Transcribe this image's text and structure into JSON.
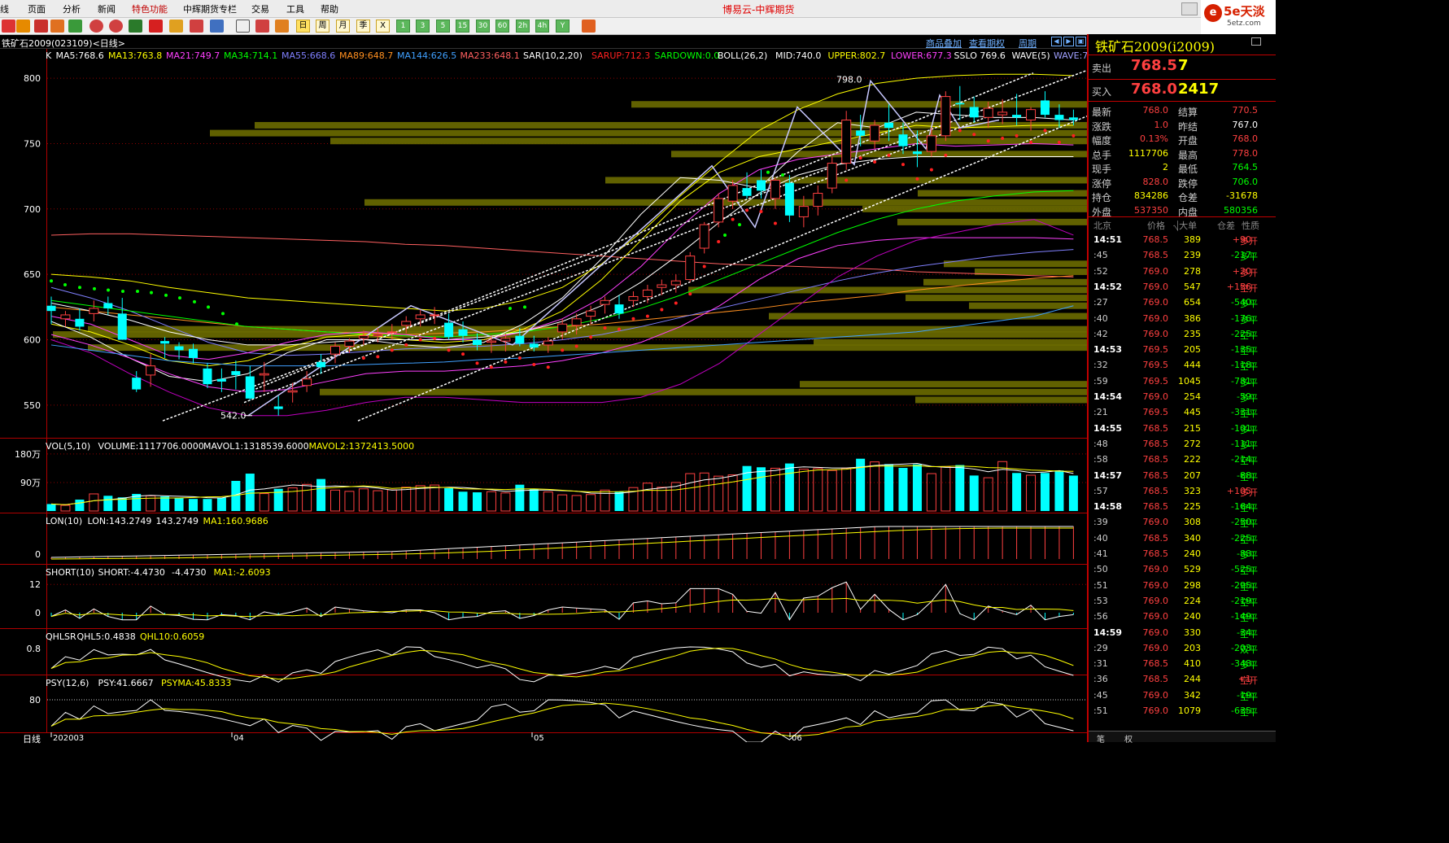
{
  "app": {
    "title": "博易云-中辉期货"
  },
  "logo": {
    "text": "5e天淡",
    "sub": "5etz.com",
    "mark": "e"
  },
  "menu": [
    "线",
    "页面",
    "分析",
    "新闻",
    "特色功能",
    "中辉期货专栏",
    "交易",
    "工具",
    "帮助"
  ],
  "toolbar": {
    "periods": [
      "日",
      "周",
      "月",
      "季",
      "X"
    ],
    "minutes": [
      "1",
      "3",
      "5",
      "15",
      "30",
      "60",
      "2h",
      "4h",
      "Y"
    ]
  },
  "subbar": {
    "title": "铁矿石2009(023109)<日线>",
    "links": [
      "商品叠加",
      "查看期权",
      "周期"
    ]
  },
  "main_panel": {
    "indicator_line": [
      {
        "t": "K",
        "c": "#ffffff"
      },
      {
        "t": "MA5:768.6",
        "c": "#ffffff"
      },
      {
        "t": "MA13:763.8",
        "c": "#ffff00"
      },
      {
        "t": "MA21:749.7",
        "c": "#ff40ff"
      },
      {
        "t": "MA34:714.1",
        "c": "#00ff00"
      },
      {
        "t": "MA55:668.6",
        "c": "#8080ff"
      },
      {
        "t": "MA89:648.7",
        "c": "#ff9020"
      },
      {
        "t": "MA144:626.5",
        "c": "#40a0ff"
      },
      {
        "t": "MA233:648.1",
        "c": "#ff6060"
      },
      {
        "t": "SAR(10,2,20)",
        "c": "#ffffff"
      },
      {
        "t": "SARUP:712.3",
        "c": "#ff2020"
      },
      {
        "t": "SARDOWN:0.0",
        "c": "#00ff00"
      },
      {
        "t": "BOLL(26,2)",
        "c": "#ffffff"
      },
      {
        "t": "MID:740.0",
        "c": "#ffffff"
      },
      {
        "t": "UPPER:802.7",
        "c": "#ffff00"
      },
      {
        "t": "LOWER:677.3",
        "c": "#ff40ff"
      },
      {
        "t": "SSLO 769.6",
        "c": "#ffffff"
      },
      {
        "t": "WAVE(5)",
        "c": "#ffffff"
      },
      {
        "t": "WAVE:768.0",
        "c": "#a0a0ff"
      }
    ],
    "yticks": [
      "800",
      "750",
      "700",
      "650",
      "600",
      "550"
    ],
    "annotations": {
      "high": "798.0",
      "low": "542.0"
    }
  },
  "vol_panel": {
    "indicator_line": [
      {
        "t": "VOL(5,10)",
        "c": "#ffffff"
      },
      {
        "t": "VOLUME:1117706.0000",
        "c": "#ffffff"
      },
      {
        "t": "MAVOL1:1318539.6000",
        "c": "#ffffff"
      },
      {
        "t": "MAVOL2:1372413.5000",
        "c": "#ffff00"
      }
    ],
    "yticks": [
      "180万",
      "90万"
    ]
  },
  "lon_panel": {
    "indicator_line": [
      {
        "t": "LON(10)",
        "c": "#ffffff"
      },
      {
        "t": "LON:143.2749",
        "c": "#ffffff"
      },
      {
        "t": "143.2749",
        "c": "#ffffff"
      },
      {
        "t": "MA1:160.9686",
        "c": "#ffff00"
      }
    ],
    "yticks": [
      "0"
    ]
  },
  "short_panel": {
    "indicator_line": [
      {
        "t": "SHORT(10)",
        "c": "#ffffff"
      },
      {
        "t": "SHORT:-4.4730",
        "c": "#ffffff"
      },
      {
        "t": "-4.4730",
        "c": "#ffffff"
      },
      {
        "t": "MA1:-2.6093",
        "c": "#ffff00"
      }
    ],
    "yticks": [
      "12",
      "0"
    ]
  },
  "qhl_panel": {
    "indicator_line": [
      {
        "t": "QHLSR",
        "c": "#ffffff"
      },
      {
        "t": "QHL5:0.4838",
        "c": "#ffffff"
      },
      {
        "t": "QHL10:0.6059",
        "c": "#ffff00"
      }
    ],
    "yticks": [
      "0.8"
    ]
  },
  "psy_panel": {
    "indicator_line": [
      {
        "t": "PSY(12,6)",
        "c": "#ffffff"
      },
      {
        "t": "PSY:41.6667",
        "c": "#ffffff"
      },
      {
        "t": "PSYMA:45.8333",
        "c": "#ffff00"
      }
    ],
    "yticks": [
      "80"
    ]
  },
  "xaxis": {
    "labels": [
      "202003",
      "04",
      "05",
      "06"
    ],
    "period_label": "日线"
  },
  "chart_data": {
    "type": "candlestick",
    "yrange": [
      530,
      815
    ],
    "candles": [
      [
        626,
        633,
        612,
        622
      ],
      [
        616,
        622,
        610,
        619
      ],
      [
        616,
        624,
        607,
        610
      ],
      [
        620,
        630,
        614,
        624
      ],
      [
        628,
        633,
        619,
        624
      ],
      [
        620,
        632,
        602,
        600
      ],
      [
        571,
        576,
        560,
        562
      ],
      [
        573,
        589,
        564,
        580
      ],
      [
        599,
        602,
        586,
        597
      ],
      [
        595,
        598,
        585,
        592
      ],
      [
        593,
        597,
        582,
        586
      ],
      [
        578,
        582,
        563,
        566
      ],
      [
        570,
        578,
        560,
        568
      ],
      [
        576,
        584,
        562,
        573
      ],
      [
        572,
        580,
        554,
        555
      ],
      [
        573,
        583,
        560,
        574
      ],
      [
        549,
        557,
        542,
        547
      ],
      [
        560,
        567,
        552,
        561
      ],
      [
        565,
        576,
        560,
        570
      ],
      [
        583,
        589,
        574,
        579
      ],
      [
        589,
        598,
        582,
        595
      ],
      [
        595,
        601,
        590,
        599
      ],
      [
        601,
        607,
        596,
        603
      ],
      [
        603,
        609,
        598,
        604
      ],
      [
        606,
        612,
        600,
        606
      ],
      [
        611,
        618,
        605,
        614
      ],
      [
        616,
        623,
        610,
        619
      ],
      [
        619,
        625,
        612,
        619
      ],
      [
        613,
        620,
        600,
        602
      ],
      [
        608,
        614,
        598,
        603
      ],
      [
        600,
        605,
        592,
        596
      ],
      [
        598,
        603,
        590,
        599
      ],
      [
        599,
        605,
        591,
        601
      ],
      [
        603,
        609,
        595,
        597
      ],
      [
        597,
        603,
        591,
        594
      ],
      [
        596,
        602,
        590,
        599
      ],
      [
        606,
        616,
        600,
        612
      ],
      [
        611,
        620,
        604,
        616
      ],
      [
        618,
        626,
        612,
        622
      ],
      [
        627,
        633,
        620,
        630
      ],
      [
        627,
        634,
        616,
        620
      ],
      [
        630,
        637,
        625,
        633
      ],
      [
        633,
        642,
        628,
        638
      ],
      [
        640,
        646,
        634,
        642
      ],
      [
        642,
        650,
        636,
        645
      ],
      [
        646,
        667,
        644,
        664
      ],
      [
        670,
        690,
        666,
        688
      ],
      [
        690,
        712,
        686,
        708
      ],
      [
        706,
        722,
        700,
        718
      ],
      [
        716,
        728,
        708,
        710
      ],
      [
        722,
        730,
        708,
        714
      ],
      [
        708,
        724,
        700,
        722
      ],
      [
        720,
        726,
        690,
        695
      ],
      [
        694,
        710,
        686,
        702
      ],
      [
        702,
        718,
        695,
        712
      ],
      [
        716,
        740,
        712,
        735
      ],
      [
        735,
        775,
        730,
        768
      ],
      [
        760,
        772,
        748,
        756
      ],
      [
        752,
        768,
        746,
        764
      ],
      [
        766,
        780,
        752,
        762
      ],
      [
        757,
        766,
        742,
        748
      ],
      [
        744,
        760,
        732,
        742
      ],
      [
        744,
        762,
        740,
        756
      ],
      [
        756,
        790,
        752,
        786
      ],
      [
        781,
        794,
        768,
        780
      ],
      [
        778,
        786,
        766,
        770
      ],
      [
        770,
        782,
        762,
        777
      ],
      [
        772,
        784,
        765,
        774
      ],
      [
        772,
        788,
        764,
        770
      ],
      [
        768,
        778,
        760,
        776
      ],
      [
        783,
        790,
        770,
        772
      ],
      [
        772,
        780,
        762,
        768
      ],
      [
        770,
        776,
        764,
        768
      ]
    ],
    "volume": {
      "yrange": [
        0,
        1900000
      ],
      "values": [
        220000,
        180000,
        360000,
        540000,
        480000,
        430000,
        540000,
        480000,
        460000,
        410000,
        380000,
        380000,
        420000,
        950000,
        1180000,
        550000,
        700000,
        730000,
        840000,
        1010000,
        660000,
        620000,
        700000,
        640000,
        670000,
        750000,
        800000,
        820000,
        720000,
        610000,
        590000,
        610000,
        570000,
        830000,
        700000,
        600000,
        510000,
        490000,
        520000,
        660000,
        620000,
        740000,
        880000,
        750000,
        900000,
        1180000,
        1200000,
        1100000,
        1140000,
        1420000,
        1380000,
        1350000,
        1500000,
        1320000,
        1340000,
        1280000,
        1350000,
        1650000,
        1550000,
        1480000,
        1360000,
        1470000,
        1180000,
        1400000,
        1450000,
        1120000,
        1050000,
        1560000,
        1200000,
        1130000,
        1200000,
        1280000,
        1117706
      ]
    },
    "up_down": "derived from candles"
  },
  "right_panel": {
    "title": "铁矿石2009(i2009)",
    "ask": {
      "label": "卖出",
      "price": "768.5",
      "vol": "7"
    },
    "bid": {
      "label": "买入",
      "price": "768.0",
      "vol": "2417"
    },
    "quote_rows": [
      {
        "l1": "最新",
        "v1": "768.0",
        "c1": "#ff4040",
        "l2": "结算",
        "v2": "770.5",
        "c2": "#ff4040"
      },
      {
        "l1": "涨跌",
        "v1": "1.0",
        "c1": "#ff4040",
        "l2": "昨结",
        "v2": "767.0",
        "c2": "#ffffff"
      },
      {
        "l1": "幅度",
        "v1": "0.13%",
        "c1": "#ff4040",
        "l2": "开盘",
        "v2": "768.0",
        "c2": "#ff4040"
      },
      {
        "l1": "总手",
        "v1": "1117706",
        "c1": "#ffff00",
        "l2": "最高",
        "v2": "778.0",
        "c2": "#ff4040"
      },
      {
        "l1": "现手",
        "v1": "2",
        "c1": "#ffff00",
        "l2": "最低",
        "v2": "764.5",
        "c2": "#00ff00"
      },
      {
        "l1": "涨停",
        "v1": "828.0",
        "c1": "#ff4040",
        "l2": "跌停",
        "v2": "706.0",
        "c2": "#00ff00"
      },
      {
        "l1": "持仓",
        "v1": "834286",
        "c1": "#ffff00",
        "l2": "仓差",
        "v2": "-31678",
        "c2": "#ffff00"
      },
      {
        "l1": "外盘",
        "v1": "537350",
        "c1": "#ff4040",
        "l2": "内盘",
        "v2": "580356",
        "c2": "#00ff00"
      }
    ],
    "tick_header": {
      "time": "北京",
      "price": "价格",
      "vol": "⎷大单",
      "chg": "仓差",
      "nature": "性质"
    },
    "ticks": [
      {
        "t": "14:51",
        "p": "768.5",
        "v": "389",
        "c": "+90",
        "n": "多开",
        "full": true
      },
      {
        "t": ":45",
        "p": "768.5",
        "v": "239",
        "c": "-217",
        "n": "多平"
      },
      {
        "t": ":52",
        "p": "769.0",
        "v": "278",
        "c": "+20",
        "n": "多开"
      },
      {
        "t": "14:52",
        "p": "769.0",
        "v": "547",
        "c": "+156",
        "n": "空开",
        "full": true
      },
      {
        "t": ":27",
        "p": "769.0",
        "v": "654",
        "c": "-540",
        "n": "多平"
      },
      {
        "t": ":40",
        "p": "769.0",
        "v": "386",
        "c": "-176",
        "n": "多平"
      },
      {
        "t": ":42",
        "p": "769.0",
        "v": "235",
        "c": "-225",
        "n": "空平"
      },
      {
        "t": "14:53",
        "p": "769.5",
        "v": "205",
        "c": "-135",
        "n": "空平",
        "full": true
      },
      {
        "t": ":32",
        "p": "769.5",
        "v": "444",
        "c": "-118",
        "n": "空平"
      },
      {
        "t": ":59",
        "p": "769.5",
        "v": "1045",
        "c": "-781",
        "n": "多平"
      },
      {
        "t": "14:54",
        "p": "769.0",
        "v": "254",
        "c": "-59",
        "n": "多平",
        "full": true
      },
      {
        "t": ":21",
        "p": "769.5",
        "v": "445",
        "c": "-331",
        "n": "空平"
      },
      {
        "t": "14:55",
        "p": "768.5",
        "v": "215",
        "c": "-101",
        "n": "多平",
        "full": true
      },
      {
        "t": ":48",
        "p": "768.5",
        "v": "272",
        "c": "-111",
        "n": "多平"
      },
      {
        "t": ":58",
        "p": "768.5",
        "v": "222",
        "c": "-214",
        "n": "空平"
      },
      {
        "t": "14:57",
        "p": "768.5",
        "v": "207",
        "c": "-88",
        "n": "空平",
        "full": true
      },
      {
        "t": ":57",
        "p": "768.5",
        "v": "323",
        "c": "+105",
        "n": "多开"
      },
      {
        "t": "14:58",
        "p": "768.5",
        "v": "225",
        "c": "-164",
        "n": "空平",
        "full": true
      },
      {
        "t": ":39",
        "p": "769.0",
        "v": "308",
        "c": "-250",
        "n": "空平"
      },
      {
        "t": ":40",
        "p": "768.5",
        "v": "340",
        "c": "-225",
        "n": "空平"
      },
      {
        "t": ":41",
        "p": "768.5",
        "v": "240",
        "c": "-88",
        "n": "多平"
      },
      {
        "t": ":50",
        "p": "769.0",
        "v": "529",
        "c": "-525",
        "n": "空平"
      },
      {
        "t": ":51",
        "p": "769.0",
        "v": "298",
        "c": "-295",
        "n": "空平"
      },
      {
        "t": ":53",
        "p": "769.0",
        "v": "224",
        "c": "-219",
        "n": "空平"
      },
      {
        "t": ":56",
        "p": "769.0",
        "v": "240",
        "c": "-149",
        "n": "空平"
      },
      {
        "t": "14:59",
        "p": "769.0",
        "v": "330",
        "c": "-34",
        "n": "空平",
        "full": true
      },
      {
        "t": ":29",
        "p": "769.0",
        "v": "203",
        "c": "-203",
        "n": "双平"
      },
      {
        "t": ":31",
        "p": "768.5",
        "v": "410",
        "c": "-348",
        "n": "多平"
      },
      {
        "t": ":36",
        "p": "768.5",
        "v": "244",
        "c": "+1",
        "n": "空开"
      },
      {
        "t": ":45",
        "p": "769.0",
        "v": "342",
        "c": "-19",
        "n": "空平"
      },
      {
        "t": ":51",
        "p": "769.0",
        "v": "1079",
        "c": "-635",
        "n": "空平"
      }
    ],
    "footer": [
      "笔",
      "权"
    ]
  },
  "colors": {
    "up": "#ff4040",
    "down": "#00ffff",
    "grid": "#8b0000",
    "band": "#6b6b00"
  }
}
